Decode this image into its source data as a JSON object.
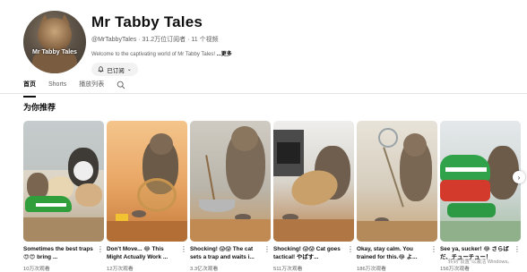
{
  "channel": {
    "avatar_text": "Mr Tabby Tales",
    "name": "Mr Tabby Tales",
    "meta": "@MrTabbyTales · 31.2万位订阅者 · 11 个视频",
    "description": "Welcome to the captivating world of Mr Tabby Tales! ",
    "more_label": "...更多",
    "subscribe_label": "已订阅",
    "subscribe_icon": "bell-icon",
    "subscribe_chevron": "⌄"
  },
  "tabs": [
    {
      "label": "首页",
      "active": true
    },
    {
      "label": "Shorts",
      "active": false
    },
    {
      "label": "播放列表",
      "active": false
    }
  ],
  "tab_search_icon": "search-icon",
  "section": {
    "title": "为你推荐"
  },
  "videos": [
    {
      "title": "Sometimes the best traps 😍😍 bring ...",
      "views": "10万次观看"
    },
    {
      "title": "Don't Move... 😂 This Might Actually Work ...",
      "views": "12万次观看"
    },
    {
      "title": "Shocking! 😱😱 The cat sets a trap and waits i...",
      "views": "3.3亿次观看"
    },
    {
      "title": "Shocking! 😱😱 Cat goes tactical! やばす...",
      "views": "511万次观看"
    },
    {
      "title": "Okay, stay calm. You trained for this.😂 よ...",
      "views": "186万次观看"
    },
    {
      "title": "See ya, sucker! 😂 さらば だ、チューチュー！",
      "views": "156万次观看"
    }
  ],
  "kebab_glyph": "⋮",
  "next_glyph": "›",
  "watermark": "转到\"设置\"以激活 Windows。"
}
